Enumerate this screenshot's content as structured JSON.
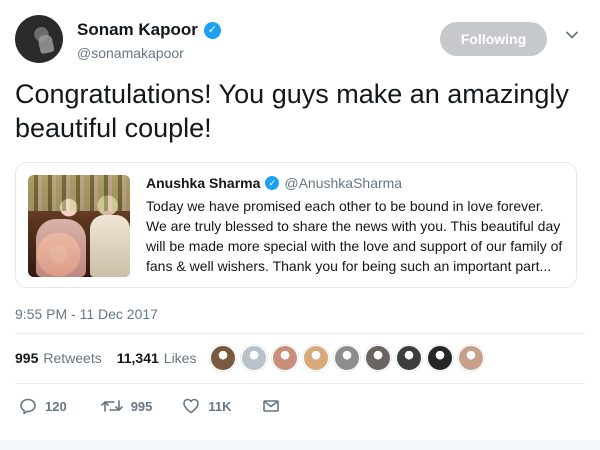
{
  "tweet": {
    "author": {
      "name": "Sonam Kapoor",
      "handle": "@sonamakapoor",
      "verified_icon": "verified-badge-icon"
    },
    "follow_button": "Following",
    "text": "Congratulations! You guys make an amazingly beautiful couple!",
    "quoted": {
      "name": "Anushka Sharma",
      "handle": "@AnushkaSharma",
      "text": "Today we have promised each other to be bound in love forever. We are truly blessed to share the news with you. This beautiful day will be made more special with the love and support of our family of fans & well wishers. Thank you for being such an important part..."
    },
    "timestamp": "9:55 PM - 11 Dec 2017",
    "stats": {
      "retweets_count": "995",
      "retweets_label": "Retweets",
      "likes_count": "11,341",
      "likes_label": "Likes"
    },
    "actions": {
      "replies": "120",
      "retweets": "995",
      "likes": "11K"
    }
  },
  "colors": {
    "accent": "#1da1f2",
    "muted": "#657786",
    "following_btn": "#c6c9cc"
  },
  "liker_avatar_colors": [
    "#7a5a3f",
    "#b9c2cb",
    "#c98f7a",
    "#d8a97b",
    "#8d8d8d",
    "#6b6560",
    "#3d3d3d",
    "#262626",
    "#c8a089"
  ]
}
